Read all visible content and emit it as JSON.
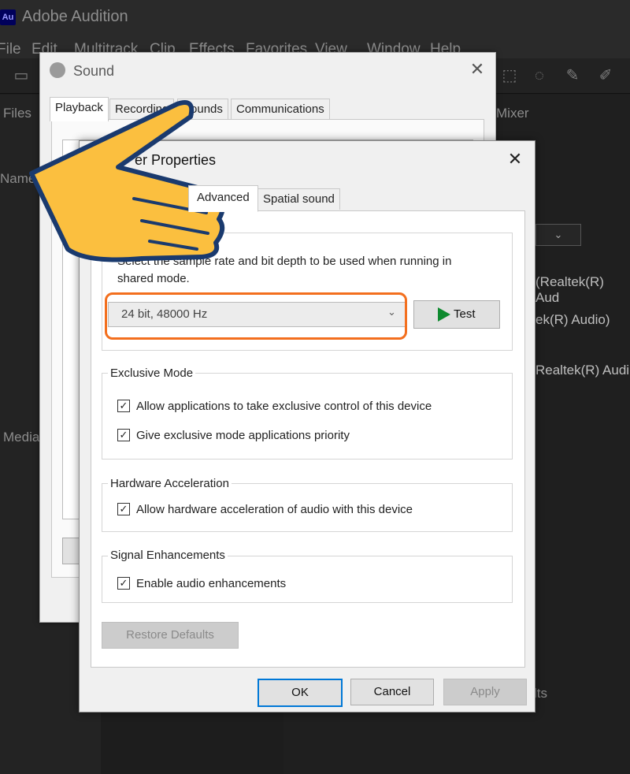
{
  "app": {
    "logo": "Au",
    "title": "Adobe Audition",
    "menu": [
      "File",
      "Edit",
      "Multitrack",
      "Clip",
      "Effects",
      "Favorites",
      "View",
      "Window",
      "Help"
    ],
    "left_labels": {
      "files": "Files",
      "name": "Name",
      "media": "Media"
    },
    "right_labels": {
      "mixer": "Mixer",
      "device_1": "(Realtek(R) Aud",
      "device_2": "ek(R) Audio)",
      "device_3": "Realtek(R) Audi",
      "bottom": "lts"
    }
  },
  "sound_dialog": {
    "title": "Sound",
    "tabs": [
      "Playback",
      "Recording",
      "Sounds",
      "Communications"
    ],
    "active_tab": "Playback",
    "close_icon": "close-icon"
  },
  "props_dialog": {
    "title": "Speaker Properties",
    "visible_title": "er Properties",
    "tabs": {
      "advanced": "Advanced",
      "spatial": "Spatial sound"
    },
    "default_format": {
      "label": "Default Format",
      "visible_label": "rmat",
      "description_line1": "Select the sample rate and bit depth to be used when running in",
      "description_line2": "shared mode.",
      "selected_format": "24 bit, 48000 Hz",
      "test_button": "Test"
    },
    "exclusive_mode": {
      "label": "Exclusive Mode",
      "options": [
        {
          "label": "Allow applications to take exclusive control of this device",
          "checked": true
        },
        {
          "label": "Give exclusive mode applications priority",
          "checked": true
        }
      ]
    },
    "hardware_acceleration": {
      "label": "Hardware Acceleration",
      "options": [
        {
          "label": "Allow hardware acceleration of audio with this device",
          "checked": true
        }
      ]
    },
    "signal_enhancements": {
      "label": "Signal Enhancements",
      "options": [
        {
          "label": "Enable audio enhancements",
          "checked": true
        }
      ]
    },
    "restore_defaults": "Restore Defaults",
    "buttons": {
      "ok": "OK",
      "cancel": "Cancel",
      "apply": "Apply"
    },
    "checkmark": "✓",
    "close_symbol": "✕",
    "caret": "⌄"
  },
  "colors": {
    "highlight": "#f36f1e",
    "hand_fill": "#fbbf3f",
    "hand_outline": "#1a3a6e",
    "test_icon": "#0e8a2f"
  }
}
